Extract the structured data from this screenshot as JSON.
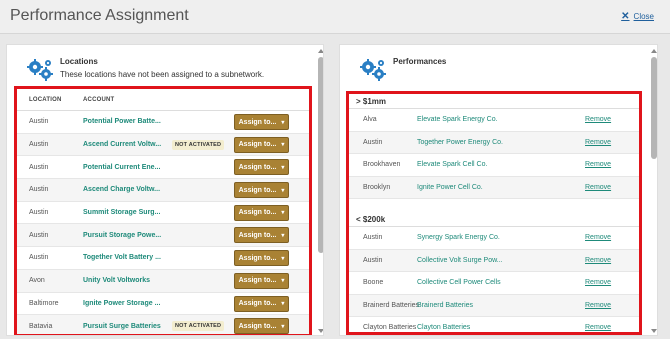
{
  "dialog": {
    "title": "Performance Assignment",
    "close_label": "Close",
    "close_icon": "close-icon"
  },
  "locations_panel": {
    "title": "Locations",
    "subtitle": "These locations have not been assigned to a subnetwork.",
    "columns": {
      "location": "LOCATION",
      "account": "ACCOUNT"
    },
    "assign_label": "Assign to...",
    "rows": [
      {
        "location": "Austin",
        "account": "Potential Power Batte...",
        "badge": ""
      },
      {
        "location": "Austin",
        "account": "Ascend Current Voltw...",
        "badge": "NOT ACTIVATED"
      },
      {
        "location": "Austin",
        "account": "Potential Current Ene...",
        "badge": ""
      },
      {
        "location": "Austin",
        "account": "Ascend Charge Voltw...",
        "badge": ""
      },
      {
        "location": "Austin",
        "account": "Summit Storage Surg...",
        "badge": ""
      },
      {
        "location": "Austin",
        "account": "Pursuit Storage Powe...",
        "badge": ""
      },
      {
        "location": "Austin",
        "account": "Together Volt Battery ...",
        "badge": ""
      },
      {
        "location": "Avon",
        "account": "Unity Volt Voltworks",
        "badge": ""
      },
      {
        "location": "Baltimore",
        "account": "Ignite Power Storage ...",
        "badge": ""
      },
      {
        "location": "Batavia",
        "account": "Pursuit Surge Batteries",
        "badge": "NOT ACTIVATED"
      }
    ]
  },
  "performances_panel": {
    "title": "Performances",
    "remove_label": "Remove",
    "groups": [
      {
        "label": "> $1mm",
        "rows": [
          {
            "location": "Alva",
            "performance": "Elevate Spark Energy Co."
          },
          {
            "location": "Austin",
            "performance": "Together Power Energy Co."
          },
          {
            "location": "Brookhaven",
            "performance": "Elevate Spark Cell Co."
          },
          {
            "location": "Brooklyn",
            "performance": "Ignite Power Cell Co."
          }
        ]
      },
      {
        "label": "< $200k",
        "rows": [
          {
            "location": "Austin",
            "performance": "Synergy Spark Energy Co."
          },
          {
            "location": "Austin",
            "performance": "Collective Volt Surge Pow..."
          },
          {
            "location": "Boone",
            "performance": "Collective Cell Power Cells"
          },
          {
            "location": "Brainerd Batteries",
            "performance": "Brainerd Batteries"
          },
          {
            "location": "Clayton Batteries",
            "performance": "Clayton Batteries"
          }
        ]
      }
    ]
  },
  "colors": {
    "accent_teal": "#1e8a7a",
    "assign_button": "#a98234",
    "highlight_border": "#e0141b",
    "gear_blue": "#2a7fc4"
  }
}
